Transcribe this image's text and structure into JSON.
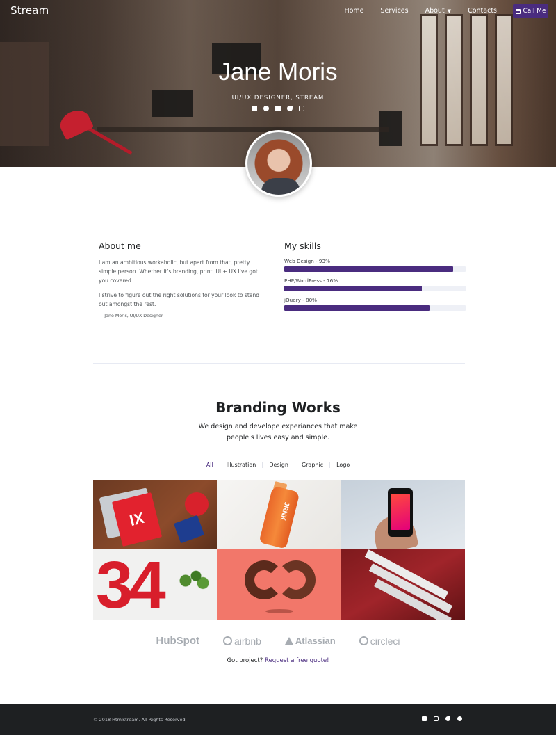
{
  "header": {
    "brand": "Stream",
    "nav": [
      {
        "label": "Home"
      },
      {
        "label": "Services"
      },
      {
        "label": "About",
        "has_dropdown": true
      },
      {
        "label": "Contacts"
      }
    ],
    "call_button": "Call Me",
    "accent_color": "#4a2c7f"
  },
  "hero": {
    "name": "Jane Moris",
    "subtitle": "UI/UX DESIGNER, STREAM",
    "social": [
      "facebook-icon",
      "dribbble-icon",
      "linkedin-icon",
      "twitter-icon",
      "instagram-icon"
    ]
  },
  "about": {
    "title": "About me",
    "paragraphs": [
      "I am an ambitious workaholic, but apart from that, pretty simple person. Whether it's branding, print, UI + UX I've got you covered.",
      "I strive to figure out the right solutions for your look to stand out amongst the rest."
    ],
    "signature": "— Jane Moris, UI/UX Designer"
  },
  "skills": {
    "title": "My skills",
    "items": [
      {
        "label": "Web Design - 93%",
        "percent": 93
      },
      {
        "label": "PHP/WordPress - 76%",
        "percent": 76
      },
      {
        "label": "jQuery - 80%",
        "percent": 80
      }
    ]
  },
  "works": {
    "title": "Branding Works",
    "description": "We design and develope experiances that make people's lives easy and simple.",
    "filters": [
      {
        "label": "All",
        "active": true
      },
      {
        "label": "Illustration"
      },
      {
        "label": "Design"
      },
      {
        "label": "Graphic"
      },
      {
        "label": "Logo"
      }
    ],
    "tiles": {
      "t1_book": "IX",
      "t2_bottle": "JRNK",
      "t4_number": "34"
    }
  },
  "clients": {
    "logos": [
      "HubSpot",
      "airbnb",
      "Atlassian",
      "circleci"
    ]
  },
  "project": {
    "text": "Got project?",
    "link": "Request a free quote!"
  },
  "footer": {
    "copyright": "© 2018 Htmlstream. All Rights Reserved.",
    "social": [
      "facebook-icon",
      "instagram-icon",
      "twitter-icon",
      "dribbble-icon"
    ]
  }
}
